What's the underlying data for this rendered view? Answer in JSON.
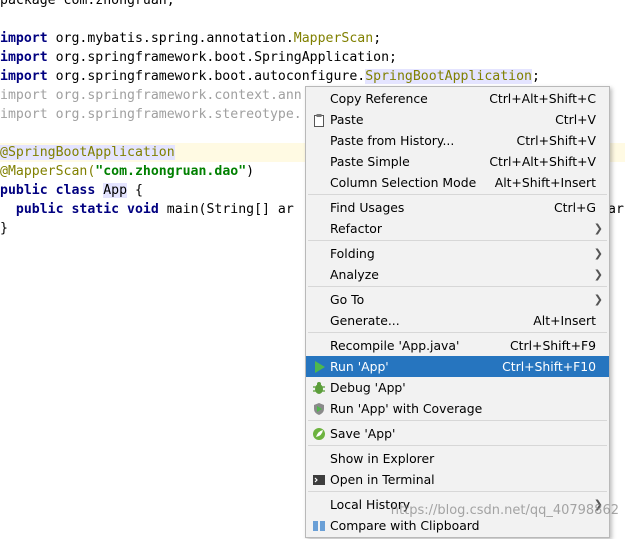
{
  "code": {
    "line0": "package com.zhongruan;",
    "line2_kw": "import",
    "line2_rest": " org.mybatis.spring.annotation.",
    "line2_cls": "MapperScan",
    "line2_end": ";",
    "line3_kw": "import",
    "line3_rest": " org.springframework.boot.SpringApplication;",
    "line4_kw": "import",
    "line4_rest": " org.springframework.boot.autoconfigure.",
    "line4_cls": "SpringBootApplication",
    "line4_end": ";",
    "line5": "import org.springframework.context.ann",
    "line6": "import org.springframework.stereotype.",
    "line8": "@SpringBootApplication",
    "line9_ann": "@MapperScan(",
    "line9_str": "\"com.zhongruan.dao\"",
    "line9_end": ")",
    "line10_kw": "public class",
    "line10_cls": "App",
    "line10_end": " {",
    "line11_kw": "public static void",
    "line11_rest": " main(String[] ar",
    "line11_tail": "ar",
    "line12": "}"
  },
  "menu": {
    "items": [
      {
        "label": "Copy Reference",
        "shortcut": "Ctrl+Alt+Shift+C"
      },
      {
        "label": "Paste",
        "shortcut": "Ctrl+V"
      },
      {
        "label": "Paste from History...",
        "shortcut": "Ctrl+Shift+V"
      },
      {
        "label": "Paste Simple",
        "shortcut": "Ctrl+Alt+Shift+V"
      },
      {
        "label": "Column Selection Mode",
        "shortcut": "Alt+Shift+Insert"
      },
      {
        "label": "Find Usages",
        "shortcut": "Ctrl+G"
      },
      {
        "label": "Refactor",
        "shortcut": ""
      },
      {
        "label": "Folding",
        "shortcut": ""
      },
      {
        "label": "Analyze",
        "shortcut": ""
      },
      {
        "label": "Go To",
        "shortcut": ""
      },
      {
        "label": "Generate...",
        "shortcut": "Alt+Insert"
      },
      {
        "label": "Recompile 'App.java'",
        "shortcut": "Ctrl+Shift+F9"
      },
      {
        "label": "Run 'App'",
        "shortcut": "Ctrl+Shift+F10"
      },
      {
        "label": "Debug 'App'",
        "shortcut": ""
      },
      {
        "label": "Run 'App' with Coverage",
        "shortcut": ""
      },
      {
        "label": "Save 'App'",
        "shortcut": ""
      },
      {
        "label": "Show in Explorer",
        "shortcut": ""
      },
      {
        "label": "Open in Terminal",
        "shortcut": ""
      },
      {
        "label": "Local History",
        "shortcut": ""
      },
      {
        "label": "Compare with Clipboard",
        "shortcut": ""
      }
    ]
  },
  "watermark": "https://blog.csdn.net/qq_40798862",
  "colors": {
    "selection": "#2675bf",
    "menu_bg": "#f2f2f2",
    "keyword": "#000080",
    "annotation": "#808000",
    "string": "#008000"
  }
}
